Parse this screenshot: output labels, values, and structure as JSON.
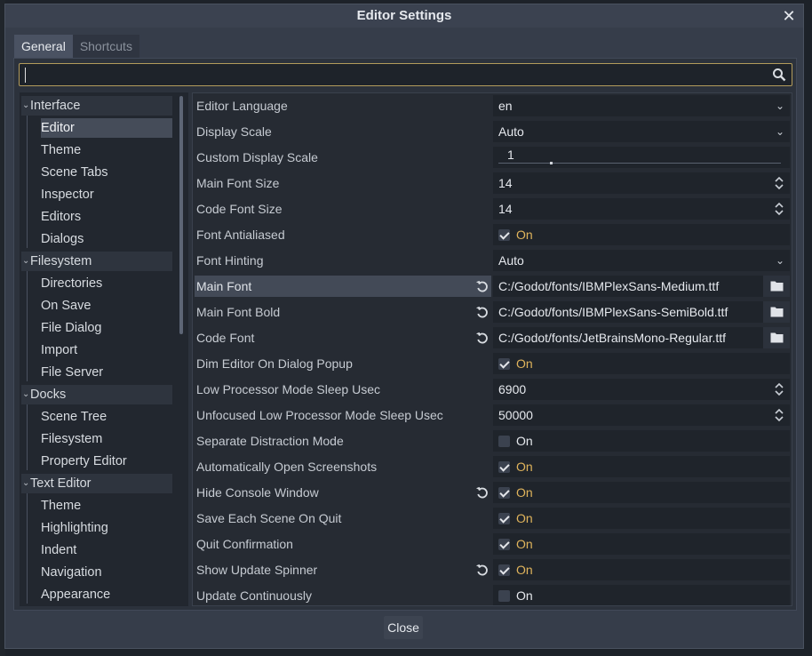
{
  "window": {
    "title": "Editor Settings"
  },
  "tabs": [
    {
      "label": "General",
      "active": true
    },
    {
      "label": "Shortcuts",
      "active": false
    }
  ],
  "search": {
    "value": "",
    "placeholder": ""
  },
  "sidebar": {
    "categories": [
      {
        "label": "Interface",
        "items": [
          "Editor",
          "Theme",
          "Scene Tabs",
          "Inspector",
          "Editors",
          "Dialogs"
        ]
      },
      {
        "label": "Filesystem",
        "items": [
          "Directories",
          "On Save",
          "File Dialog",
          "Import",
          "File Server"
        ]
      },
      {
        "label": "Docks",
        "items": [
          "Scene Tree",
          "Filesystem",
          "Property Editor"
        ]
      },
      {
        "label": "Text Editor",
        "items": [
          "Theme",
          "Highlighting",
          "Indent",
          "Navigation",
          "Appearance"
        ]
      }
    ],
    "selected": "Editor"
  },
  "settings": [
    {
      "label": "Editor Language",
      "type": "dropdown",
      "value": "en"
    },
    {
      "label": "Display Scale",
      "type": "dropdown",
      "value": "Auto"
    },
    {
      "label": "Custom Display Scale",
      "type": "slider",
      "value": "1"
    },
    {
      "label": "Main Font Size",
      "type": "spin",
      "value": "14"
    },
    {
      "label": "Code Font Size",
      "type": "spin",
      "value": "14"
    },
    {
      "label": "Font Antialiased",
      "type": "check",
      "checked": true,
      "text": "On"
    },
    {
      "label": "Font Hinting",
      "type": "dropdown",
      "value": "Auto"
    },
    {
      "label": "Main Font",
      "type": "path",
      "value": "C:/Godot/fonts/IBMPlexSans-Medium.ttf",
      "revert": true,
      "highlight": true
    },
    {
      "label": "Main Font Bold",
      "type": "path",
      "value": "C:/Godot/fonts/IBMPlexSans-SemiBold.ttf",
      "revert": true
    },
    {
      "label": "Code Font",
      "type": "path",
      "value": "C:/Godot/fonts/JetBrainsMono-Regular.ttf",
      "revert": true
    },
    {
      "label": "Dim Editor On Dialog Popup",
      "type": "check",
      "checked": true,
      "text": "On"
    },
    {
      "label": "Low Processor Mode Sleep Usec",
      "type": "spin",
      "value": "6900"
    },
    {
      "label": "Unfocused Low Processor Mode Sleep Usec",
      "type": "spin",
      "value": "50000"
    },
    {
      "label": "Separate Distraction Mode",
      "type": "check",
      "checked": false,
      "text": "On"
    },
    {
      "label": "Automatically Open Screenshots",
      "type": "check",
      "checked": true,
      "text": "On"
    },
    {
      "label": "Hide Console Window",
      "type": "check",
      "checked": true,
      "text": "On",
      "revert": true
    },
    {
      "label": "Save Each Scene On Quit",
      "type": "check",
      "checked": true,
      "text": "On"
    },
    {
      "label": "Quit Confirmation",
      "type": "check",
      "checked": true,
      "text": "On"
    },
    {
      "label": "Show Update Spinner",
      "type": "check",
      "checked": true,
      "text": "On",
      "revert": true
    },
    {
      "label": "Update Continuously",
      "type": "check",
      "checked": false,
      "text": "On"
    }
  ],
  "footer": {
    "close_label": "Close"
  },
  "colors": {
    "accent": "#e0b45c",
    "search_border": "#b39b5b"
  }
}
